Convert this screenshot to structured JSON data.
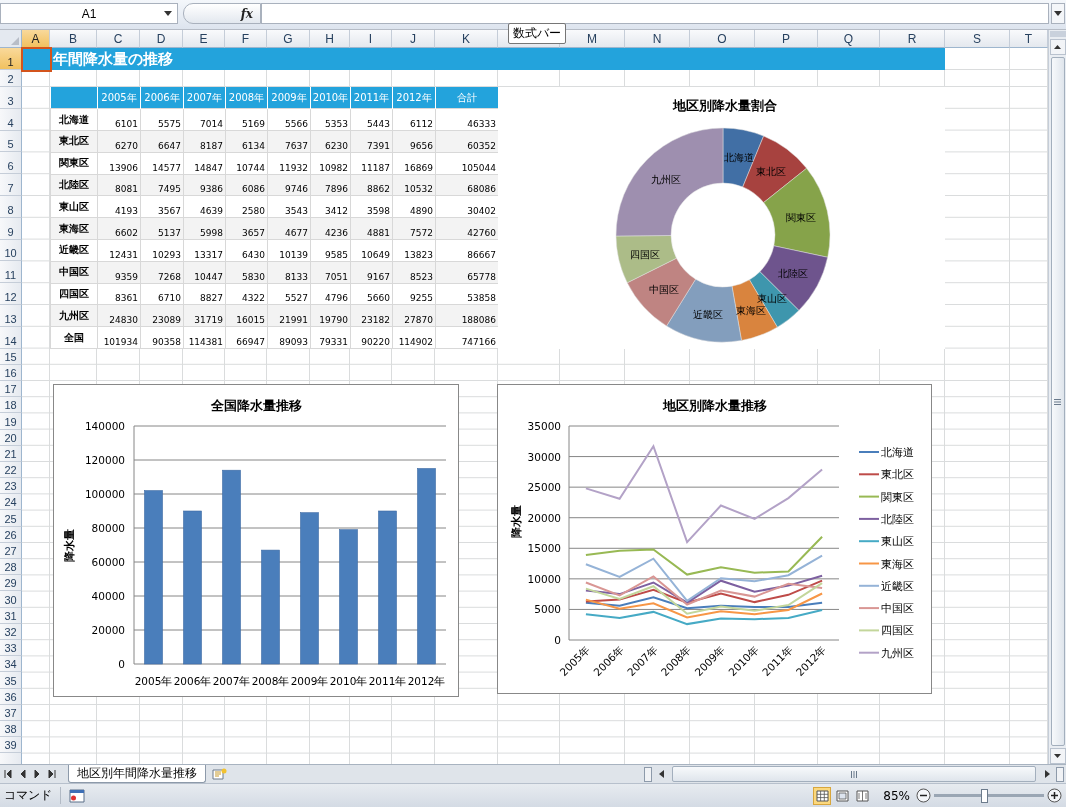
{
  "formula_bar": {
    "name_box": "A1",
    "function_button": "fx",
    "tooltip": "数式バー"
  },
  "column_headers": [
    {
      "label": "A",
      "selected": true
    },
    {
      "label": "B",
      "selected": false
    },
    {
      "label": "C",
      "selected": false
    },
    {
      "label": "D",
      "selected": false
    },
    {
      "label": "E",
      "selected": false
    },
    {
      "label": "F",
      "selected": false
    },
    {
      "label": "G",
      "selected": false
    },
    {
      "label": "H",
      "selected": false
    },
    {
      "label": "I",
      "selected": false
    },
    {
      "label": "J",
      "selected": false
    },
    {
      "label": "K",
      "selected": false
    },
    {
      "selected": false
    },
    {
      "label": "M",
      "selected": false
    },
    {
      "label": "N",
      "selected": false
    },
    {
      "label": "O",
      "selected": false
    },
    {
      "label": "P",
      "selected": false
    },
    {
      "label": "Q",
      "selected": false
    },
    {
      "label": "R",
      "selected": false
    },
    {
      "label": "S",
      "selected": false
    },
    {
      "label": "T",
      "selected": false
    }
  ],
  "row_headers": [
    {
      "label": "1",
      "selected": true
    },
    {
      "label": "2",
      "selected": false
    },
    {
      "label": "3",
      "selected": false
    },
    {
      "label": "4",
      "selected": false
    },
    {
      "label": "5",
      "selected": false
    },
    {
      "label": "6",
      "selected": false
    },
    {
      "label": "7",
      "selected": false
    },
    {
      "label": "8",
      "selected": false
    },
    {
      "label": "9",
      "selected": false
    },
    {
      "label": "10",
      "selected": false
    },
    {
      "label": "11",
      "selected": false
    },
    {
      "label": "12",
      "selected": false
    },
    {
      "label": "13",
      "selected": false
    },
    {
      "label": "14",
      "selected": false
    },
    {
      "label": "15",
      "selected": false
    },
    {
      "label": "16",
      "selected": false
    },
    {
      "label": "17",
      "selected": false
    },
    {
      "label": "18",
      "selected": false
    },
    {
      "label": "19",
      "selected": false
    },
    {
      "label": "20",
      "selected": false
    },
    {
      "label": "21",
      "selected": false
    },
    {
      "label": "22",
      "selected": false
    },
    {
      "label": "23",
      "selected": false
    },
    {
      "label": "24",
      "selected": false
    },
    {
      "label": "25",
      "selected": false
    },
    {
      "label": "26",
      "selected": false
    },
    {
      "label": "27",
      "selected": false
    },
    {
      "label": "28",
      "selected": false
    },
    {
      "label": "29",
      "selected": false
    },
    {
      "label": "30",
      "selected": false
    },
    {
      "label": "31",
      "selected": false
    },
    {
      "label": "32",
      "selected": false
    },
    {
      "label": "33",
      "selected": false
    },
    {
      "label": "34",
      "selected": false
    },
    {
      "label": "35",
      "selected": false
    },
    {
      "label": "36",
      "selected": false
    },
    {
      "label": "37",
      "selected": false
    },
    {
      "label": "38",
      "selected": false
    },
    {
      "label": "39",
      "selected": false
    }
  ],
  "sheet_title": "年間降水量の推移",
  "table": {
    "columns": [
      "2005年",
      "2006年",
      "2007年",
      "2008年",
      "2009年",
      "2010年",
      "2011年",
      "2012年",
      "合計"
    ],
    "rows": [
      {
        "name": "北海道",
        "values": [
          "6101",
          "5575",
          "7014",
          "5169",
          "5566",
          "5353",
          "5443",
          "6112",
          "46333"
        ]
      },
      {
        "name": "東北区",
        "values": [
          "6270",
          "6647",
          "8187",
          "6134",
          "7637",
          "6230",
          "7391",
          "9656",
          "60352"
        ]
      },
      {
        "name": "関東区",
        "values": [
          "13906",
          "14577",
          "14847",
          "10744",
          "11932",
          "10982",
          "11187",
          "16869",
          "105044"
        ]
      },
      {
        "name": "北陸区",
        "values": [
          "8081",
          "7495",
          "9386",
          "6086",
          "9746",
          "7896",
          "8862",
          "10532",
          "68086"
        ]
      },
      {
        "name": "東山区",
        "values": [
          "4193",
          "3567",
          "4639",
          "2580",
          "3543",
          "3412",
          "3598",
          "4890",
          "30402"
        ]
      },
      {
        "name": "東海区",
        "values": [
          "6602",
          "5137",
          "5998",
          "3657",
          "4677",
          "4236",
          "4881",
          "7572",
          "42760"
        ]
      },
      {
        "name": "近畿区",
        "values": [
          "12431",
          "10293",
          "13317",
          "6430",
          "10139",
          "9585",
          "10649",
          "13823",
          "86667"
        ]
      },
      {
        "name": "中国区",
        "values": [
          "9359",
          "7268",
          "10447",
          "5830",
          "8133",
          "7051",
          "9167",
          "8523",
          "65778"
        ]
      },
      {
        "name": "四国区",
        "values": [
          "8361",
          "6710",
          "8827",
          "4322",
          "5527",
          "4796",
          "5660",
          "9255",
          "53858"
        ]
      },
      {
        "name": "九州区",
        "values": [
          "24830",
          "23089",
          "31719",
          "16015",
          "21991",
          "19790",
          "23182",
          "27870",
          "188086"
        ]
      },
      {
        "name": "全国",
        "values": [
          "101934",
          "90358",
          "114381",
          "66947",
          "89093",
          "79331",
          "90220",
          "114902",
          "747166"
        ]
      }
    ]
  },
  "charts": [
    {
      "chart_data": {
        "type": "donut",
        "title": "地区別降水量割合",
        "categories": [
          "北海道",
          "東北区",
          "関東区",
          "北陸区",
          "東山区",
          "東海区",
          "近畿区",
          "中国区",
          "四国区",
          "九州区"
        ],
        "values": [
          6.2,
          8.08,
          14.06,
          9.11,
          4.07,
          5.72,
          11.6,
          8.8,
          7.21,
          25.15
        ]
      }
    },
    {
      "chart_data": {
        "type": "bar",
        "title": "全国降水量推移",
        "ylabel": "降水量",
        "grid": true,
        "categories": [
          "2005年",
          "2006年",
          "2007年",
          "2008年",
          "2009年",
          "2010年",
          "2011年",
          "2012年"
        ],
        "values": [
          102000,
          90000,
          114000,
          67000,
          89000,
          79000,
          90000,
          115000
        ],
        "ylim": [
          0,
          140000
        ],
        "yticks": [
          0,
          20000,
          40000,
          60000,
          80000,
          100000,
          120000,
          140000
        ]
      }
    },
    {
      "chart_data": {
        "type": "line",
        "title": "地区別降水量推移",
        "ylabel": "降水量",
        "grid": true,
        "legend": true,
        "categories": [
          "2005年",
          "2006年",
          "2007年",
          "2008年",
          "2009年",
          "2010年",
          "2011年",
          "2012年"
        ],
        "ylim": [
          0,
          35000
        ],
        "yticks": [
          0,
          5000,
          10000,
          15000,
          20000,
          25000,
          30000,
          35000
        ],
        "series": [
          {
            "name": "北海道",
            "color": "#4a7ebb",
            "values": [
              6100,
              5600,
              7000,
              5200,
              5600,
              5400,
              5400,
              6100
            ]
          },
          {
            "name": "東北区",
            "color": "#be4b48",
            "values": [
              6300,
              6600,
              8200,
              6100,
              7600,
              6200,
              7400,
              9700
            ]
          },
          {
            "name": "関東区",
            "color": "#98b954",
            "values": [
              13900,
              14600,
              14800,
              10700,
              11900,
              11000,
              11200,
              16900
            ]
          },
          {
            "name": "北陸区",
            "color": "#7d60a0",
            "values": [
              8100,
              7500,
              9400,
              6100,
              9700,
              7900,
              8900,
              10500
            ]
          },
          {
            "name": "東山区",
            "color": "#46aac5",
            "values": [
              4200,
              3600,
              4600,
              2600,
              3500,
              3400,
              3600,
              4900
            ]
          },
          {
            "name": "東海区",
            "color": "#f79646",
            "values": [
              6600,
              5100,
              6000,
              3700,
              4700,
              4200,
              4900,
              7600
            ]
          },
          {
            "name": "近畿区",
            "color": "#95b3d7",
            "values": [
              12400,
              10300,
              13300,
              6400,
              10100,
              9600,
              10600,
              13800
            ]
          },
          {
            "name": "中国区",
            "color": "#d99694",
            "values": [
              9400,
              7300,
              10400,
              5800,
              8100,
              7100,
              9200,
              8500
            ]
          },
          {
            "name": "四国区",
            "color": "#c3d69b",
            "values": [
              8400,
              6700,
              8800,
              4300,
              5500,
              4800,
              5700,
              9300
            ]
          },
          {
            "name": "九州区",
            "color": "#b3a2c7",
            "values": [
              24800,
              23100,
              31700,
              16000,
              22000,
              19800,
              23200,
              27900
            ]
          }
        ]
      }
    }
  ],
  "sheet_tabs": [
    {
      "label": "地区別年間降水量推移",
      "selected": true
    }
  ],
  "status_bar": {
    "mode": "コマンド",
    "views": [
      {
        "kind": "normal",
        "selected": true
      },
      {
        "kind": "page_layout",
        "selected": false
      },
      {
        "kind": "page_break",
        "selected": false
      }
    ],
    "zoom": "85%",
    "zoom_slider": {
      "level": 0.45
    }
  }
}
